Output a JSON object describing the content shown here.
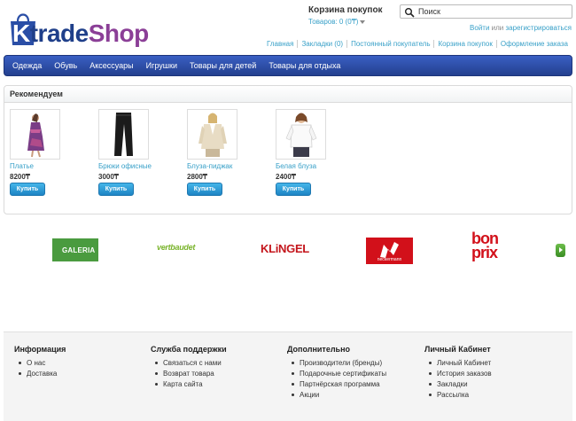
{
  "logo": {
    "part1": "K",
    "part2": "trade",
    "part3": "Shop"
  },
  "cart": {
    "title": "Корзина покупок",
    "summary": "Товаров: 0 (0₸)"
  },
  "search": {
    "placeholder": "Поиск"
  },
  "account": {
    "login": "Войти",
    "or": "или",
    "register": "зарегистрироваться"
  },
  "top_links": [
    "Главная",
    "Закладки (0)",
    "Постоянный покупатель",
    "Корзина покупок",
    "Оформление заказа"
  ],
  "menu": [
    "Одежда",
    "Обувь",
    "Аксессуары",
    "Игрушки",
    "Товары для детей",
    "Товары для отдыха"
  ],
  "recommended": {
    "title": "Рекомендуем",
    "buy_label": "Купить",
    "products": [
      {
        "name": "Платье",
        "price": "8200₸"
      },
      {
        "name": "Брюки офисные",
        "price": "3000₸"
      },
      {
        "name": "Блуза-пиджак",
        "price": "2800₸"
      },
      {
        "name": "Белая блуза",
        "price": "2400₸"
      }
    ]
  },
  "brands": {
    "galeria": "GALERIA",
    "vertbaudet": "vertbaudet",
    "klingel": "KLiNGEL",
    "neckermann": "neckermann",
    "bonprix_1": "bon",
    "bonprix_2": "prix"
  },
  "footer": {
    "columns": [
      {
        "title": "Информация",
        "items": [
          "О нас",
          "Доставка"
        ]
      },
      {
        "title": "Служба поддержки",
        "items": [
          "Связаться с нами",
          "Возврат товара",
          "Карта сайта"
        ]
      },
      {
        "title": "Дополнительно",
        "items": [
          "Производители (бренды)",
          "Подарочные сертификаты",
          "Партнёрская программа",
          "Акции"
        ]
      },
      {
        "title": "Личный Кабинет",
        "items": [
          "Личный Кабинет",
          "История заказов",
          "Закладки",
          "Рассылка"
        ]
      }
    ]
  },
  "colors": {
    "menu": "#2d4fae",
    "link": "#38a0c8",
    "buy_button": "#2a9ad6",
    "brand_blue": "#1f3f8a",
    "brand_purple": "#8b3f97"
  }
}
